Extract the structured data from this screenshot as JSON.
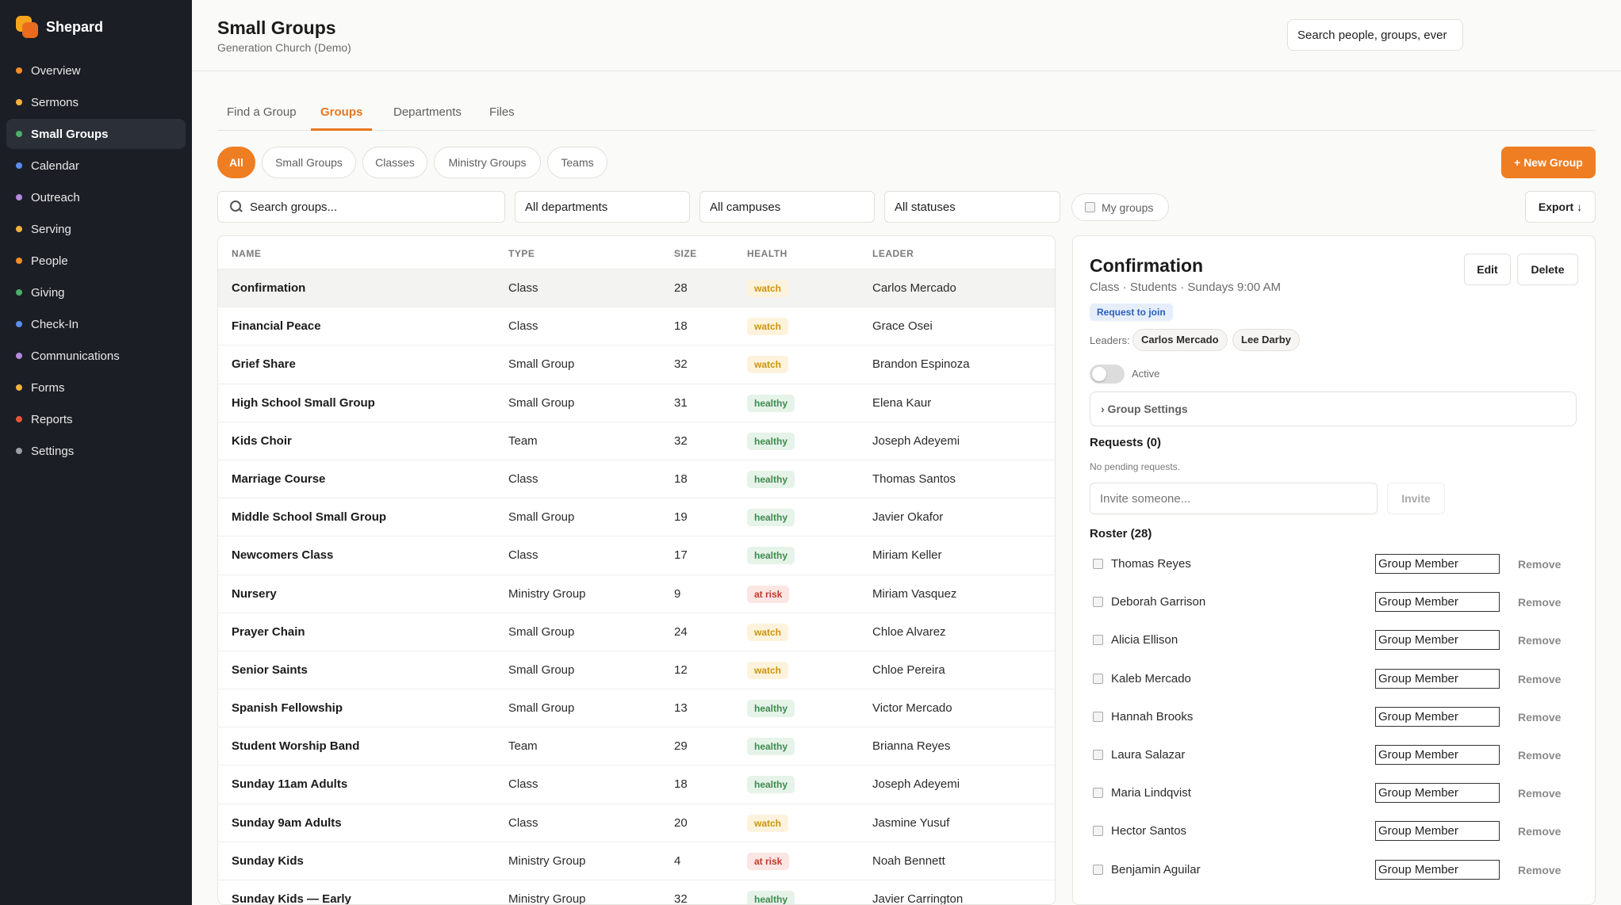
{
  "app": {
    "name": "Shepard"
  },
  "colors": {
    "accent": "#ef7d22",
    "sidebar_bg": "#1b1e25",
    "watch": "#c99412",
    "healthy": "#3f8a4f",
    "at_risk": "#c0392b"
  },
  "sidebar": {
    "items": [
      {
        "label": "Overview",
        "dot": "#f28c28"
      },
      {
        "label": "Sermons",
        "dot": "#f2b33d"
      },
      {
        "label": "Small Groups",
        "dot": "#4caf6a",
        "active": true
      },
      {
        "label": "Calendar",
        "dot": "#5b8def"
      },
      {
        "label": "Outreach",
        "dot": "#b48ade"
      },
      {
        "label": "Serving",
        "dot": "#f2b33d"
      },
      {
        "label": "People",
        "dot": "#f28c28"
      },
      {
        "label": "Giving",
        "dot": "#4caf6a"
      },
      {
        "label": "Check-In",
        "dot": "#5b8def"
      },
      {
        "label": "Communications",
        "dot": "#b48ade"
      },
      {
        "label": "Forms",
        "dot": "#f2b33d"
      },
      {
        "label": "Reports",
        "dot": "#e8553a"
      },
      {
        "label": "Settings",
        "dot": "#9aa0a6"
      }
    ]
  },
  "header": {
    "title": "Small Groups",
    "subtitle": "Generation Church (Demo)",
    "search_value": "Search people, groups, ever"
  },
  "tabs": [
    "Find a Group",
    "Groups",
    "Departments",
    "Files"
  ],
  "pills": [
    "All",
    "Small Groups",
    "Classes",
    "Ministry Groups",
    "Teams"
  ],
  "new_group_label": "+ New Group",
  "filters": {
    "search_placeholder": "Search groups...",
    "department": "All departments",
    "campus": "All campuses",
    "status": "All statuses",
    "my_groups": "My groups",
    "export": "Export ↓"
  },
  "table": {
    "columns": [
      "NAME",
      "TYPE",
      "SIZE",
      "HEALTH",
      "LEADER"
    ],
    "rows": [
      {
        "name": "Confirmation",
        "type": "Class",
        "size": "28",
        "health": "watch",
        "leader": "Carlos Mercado"
      },
      {
        "name": "Financial Peace",
        "type": "Class",
        "size": "18",
        "health": "watch",
        "leader": "Grace Osei"
      },
      {
        "name": "Grief Share",
        "type": "Small Group",
        "size": "32",
        "health": "watch",
        "leader": "Brandon Espinoza"
      },
      {
        "name": "High School Small Group",
        "type": "Small Group",
        "size": "31",
        "health": "healthy",
        "leader": "Elena Kaur"
      },
      {
        "name": "Kids Choir",
        "type": "Team",
        "size": "32",
        "health": "healthy",
        "leader": "Joseph Adeyemi"
      },
      {
        "name": "Marriage Course",
        "type": "Class",
        "size": "18",
        "health": "healthy",
        "leader": "Thomas Santos"
      },
      {
        "name": "Middle School Small Group",
        "type": "Small Group",
        "size": "19",
        "health": "healthy",
        "leader": "Javier Okafor"
      },
      {
        "name": "Newcomers Class",
        "type": "Class",
        "size": "17",
        "health": "healthy",
        "leader": "Miriam Keller"
      },
      {
        "name": "Nursery",
        "type": "Ministry Group",
        "size": "9",
        "health": "at risk",
        "leader": "Miriam Vasquez"
      },
      {
        "name": "Prayer Chain",
        "type": "Small Group",
        "size": "24",
        "health": "watch",
        "leader": "Chloe Alvarez"
      },
      {
        "name": "Senior Saints",
        "type": "Small Group",
        "size": "12",
        "health": "watch",
        "leader": "Chloe Pereira"
      },
      {
        "name": "Spanish Fellowship",
        "type": "Small Group",
        "size": "13",
        "health": "healthy",
        "leader": "Victor Mercado"
      },
      {
        "name": "Student Worship Band",
        "type": "Team",
        "size": "29",
        "health": "healthy",
        "leader": "Brianna Reyes"
      },
      {
        "name": "Sunday 11am Adults",
        "type": "Class",
        "size": "18",
        "health": "healthy",
        "leader": "Joseph Adeyemi"
      },
      {
        "name": "Sunday 9am Adults",
        "type": "Class",
        "size": "20",
        "health": "watch",
        "leader": "Jasmine Yusuf"
      },
      {
        "name": "Sunday Kids",
        "type": "Ministry Group",
        "size": "4",
        "health": "at risk",
        "leader": "Noah Bennett"
      },
      {
        "name": "Sunday Kids — Early",
        "type": "Ministry Group",
        "size": "32",
        "health": "healthy",
        "leader": "Javier Carrington"
      }
    ]
  },
  "detail": {
    "title": "Confirmation",
    "meta": "Class · Students · Sundays 9:00 AM",
    "request_badge": "Request to join",
    "edit_label": "Edit",
    "delete_label": "Delete",
    "leaders_label": "Leaders:",
    "leaders": [
      "Carlos Mercado",
      "Lee Darby"
    ],
    "status_label": "Active",
    "settings_label": "› Group Settings",
    "requests_title": "Requests (0)",
    "no_pending": "No pending requests.",
    "invite_placeholder": "Invite someone...",
    "invite_label": "Invite",
    "roster_title": "Roster (28)",
    "remove_label": "Remove",
    "roster": [
      {
        "name": "Thomas Reyes",
        "role": "Group Member"
      },
      {
        "name": "Deborah Garrison",
        "role": "Group Member"
      },
      {
        "name": "Alicia Ellison",
        "role": "Group Member"
      },
      {
        "name": "Kaleb Mercado",
        "role": "Group Member"
      },
      {
        "name": "Hannah Brooks",
        "role": "Group Member"
      },
      {
        "name": "Laura Salazar",
        "role": "Group Member"
      },
      {
        "name": "Maria Lindqvist",
        "role": "Group Member"
      },
      {
        "name": "Hector Santos",
        "role": "Group Member"
      },
      {
        "name": "Benjamin Aguilar",
        "role": "Group Member"
      }
    ]
  }
}
